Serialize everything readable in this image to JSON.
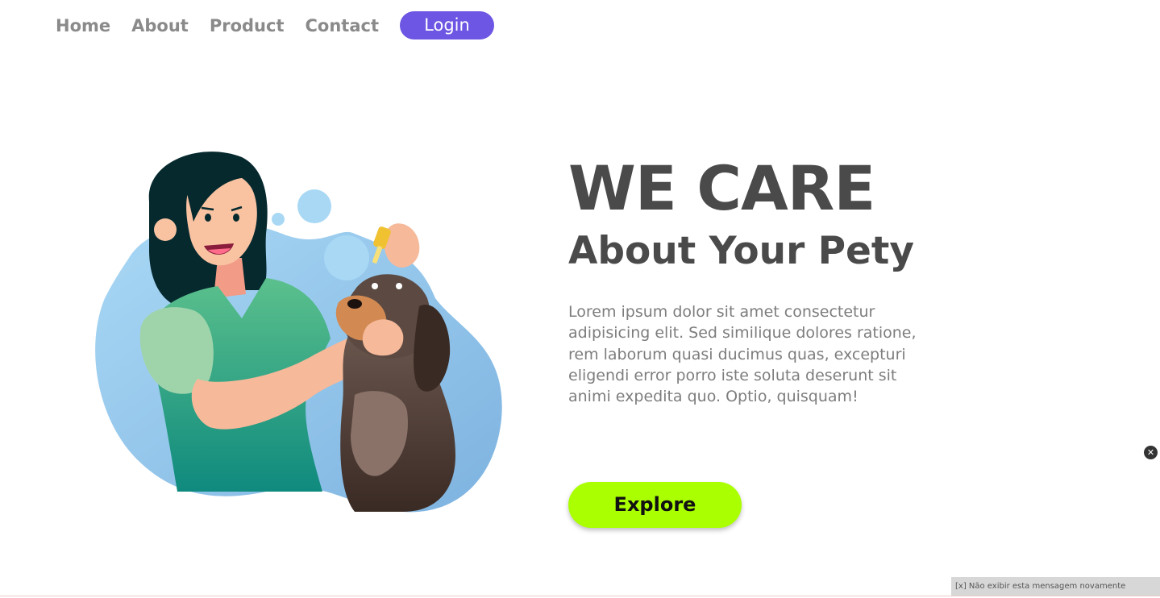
{
  "nav": {
    "links": [
      {
        "label": "Home"
      },
      {
        "label": "About"
      },
      {
        "label": "Product"
      },
      {
        "label": "Contact"
      }
    ],
    "login_label": "Login"
  },
  "hero": {
    "title": "WE CARE",
    "subtitle": "About Your Pety",
    "description": "Lorem ipsum dolor sit amet consectetur adipisicing elit. Sed similique dolores ratione, rem laborum quasi ducimus quas, excepturi eligendi error porro iste soluta deserunt sit animi expedita quo. Optio, quisquam!",
    "cta_label": "Explore"
  },
  "close_icon_glyph": "✕",
  "notice": {
    "text": "[x] Não exibir esta mensagem novamente"
  },
  "colors": {
    "accent": "#6c56e3",
    "cta": "#aaff00",
    "heading": "#4a4a4a",
    "body_text": "#7d7d7d",
    "nav_text": "#8a8a8a"
  },
  "icons": {
    "close": "close-icon"
  }
}
